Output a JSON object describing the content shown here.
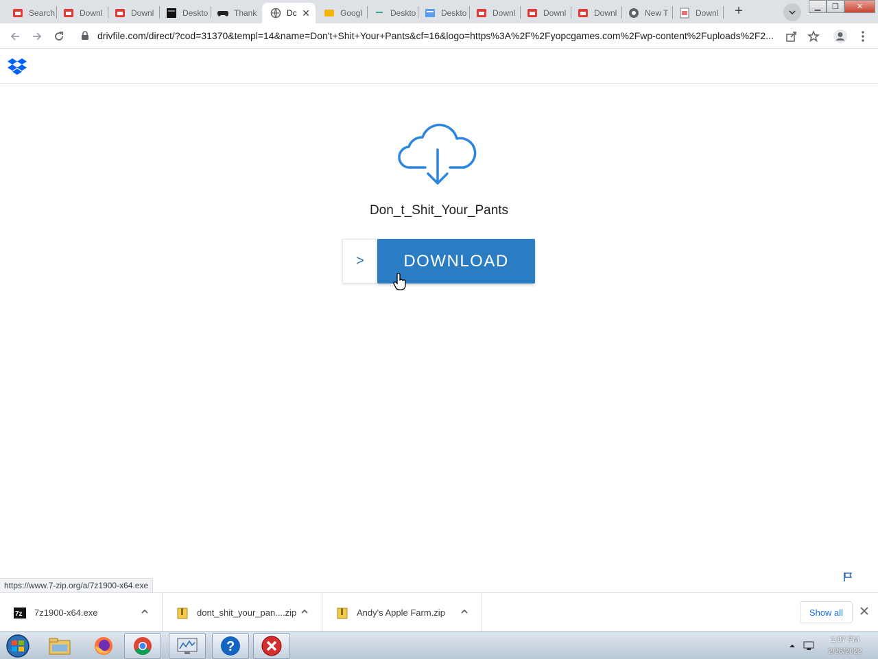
{
  "browser": {
    "tabs": [
      {
        "title": "Search",
        "icon": "red-page-icon"
      },
      {
        "title": "Downl",
        "icon": "red-page-icon"
      },
      {
        "title": "Downl",
        "icon": "red-page-icon"
      },
      {
        "title": "Deskto",
        "icon": "dark-window-icon"
      },
      {
        "title": "Thank",
        "icon": "gamepad-icon"
      },
      {
        "title": "Dc",
        "icon": "globe-icon",
        "active": true
      },
      {
        "title": "Googl",
        "icon": "yellow-page-icon"
      },
      {
        "title": "Deskto",
        "icon": "teal-page-icon"
      },
      {
        "title": "Deskto",
        "icon": "blue-page-icon"
      },
      {
        "title": "Downl",
        "icon": "red-page-icon"
      },
      {
        "title": "Downl",
        "icon": "red-page-icon"
      },
      {
        "title": "Downl",
        "icon": "red-page-icon"
      },
      {
        "title": "New T",
        "icon": "chrome-icon"
      },
      {
        "title": "Downl",
        "icon": "doc-icon"
      }
    ],
    "url": "drivfile.com/direct/?cod=31370&templ=14&name=Don't+Shit+Your+Pants&cf=16&logo=https%3A%2F%2Fyopcgames.com%2Fwp-content%2Fuploads%2F2..."
  },
  "page": {
    "filename": "Don_t_Shit_Your_Pants",
    "download_arrow": ">",
    "download_label": "DOWNLOAD",
    "accent_color": "#2a7dc2"
  },
  "status_url": "https://www.7-zip.org/a/7z1900-x64.exe",
  "downloads": {
    "items": [
      {
        "name": "7z1900-x64.exe",
        "icon": "7zip-icon"
      },
      {
        "name": "dont_shit_your_pan....zip",
        "icon": "zip-folder-icon"
      },
      {
        "name": "Andy's Apple Farm.zip",
        "icon": "zip-folder-icon"
      }
    ],
    "show_all": "Show all"
  },
  "taskbar": {
    "time": "1:07 PM",
    "date": "2/26/2022"
  }
}
